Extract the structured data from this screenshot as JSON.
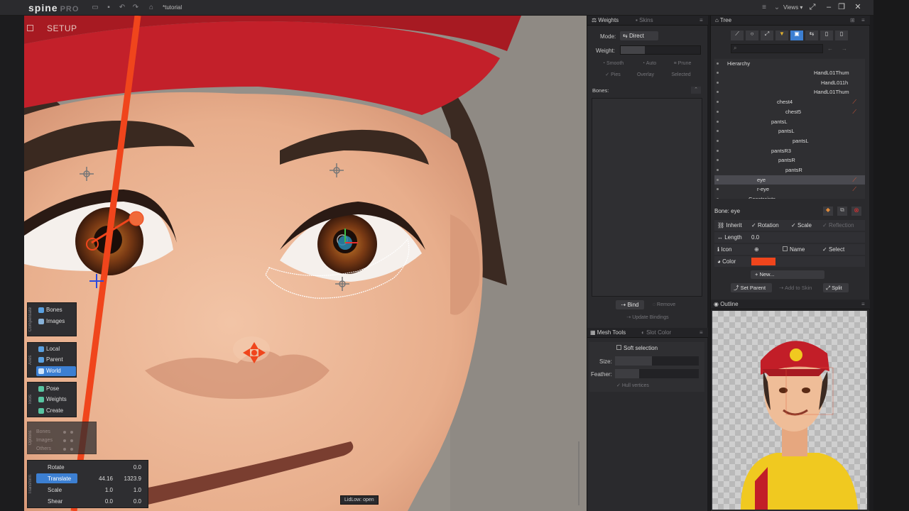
{
  "app": {
    "logo": "spine",
    "logo_suffix": "PRO",
    "document_title": "*tutorial",
    "views_menu": "Views"
  },
  "viewport": {
    "mode_label": "SETUP",
    "status_text": "LidLow: open"
  },
  "compensate": {
    "label": "Compensate",
    "items": [
      {
        "label": "Bones"
      },
      {
        "label": "Images"
      }
    ]
  },
  "axes": {
    "label": "Axes",
    "items": [
      {
        "label": "Local",
        "active": false
      },
      {
        "label": "Parent",
        "active": false
      },
      {
        "label": "World",
        "active": true
      }
    ]
  },
  "tools": {
    "label": "Tools",
    "items": [
      {
        "label": "Pose",
        "active": false
      },
      {
        "label": "Weights",
        "active": false
      },
      {
        "label": "Create",
        "active": false
      }
    ]
  },
  "options": {
    "label": "Options",
    "rows": [
      "Bones",
      "Images",
      "Others"
    ]
  },
  "transform": {
    "label": "Transform",
    "rows": [
      {
        "label": "Rotate",
        "v1": "",
        "v2": "0.0",
        "active": false
      },
      {
        "label": "Translate",
        "v1": "44.16",
        "v2": "1323.9",
        "active": true
      },
      {
        "label": "Scale",
        "v1": "1.0",
        "v2": "1.0",
        "active": false
      },
      {
        "label": "Shear",
        "v1": "0.0",
        "v2": "0.0",
        "active": false
      }
    ]
  },
  "weights_panel": {
    "tabs": [
      "Weights",
      "Skins"
    ],
    "mode_label": "Mode:",
    "mode_value": "Direct",
    "weight_label": "Weight:",
    "buttons_row1": [
      "Smooth",
      "Auto",
      "Prune"
    ],
    "buttons_row2": [
      "Pies",
      "Overlay",
      "Selected"
    ],
    "bones_label": "Bones:",
    "bind_label": "Bind",
    "remove_label": "Remove",
    "update_label": "Update Bindings"
  },
  "mesh_tools": {
    "tabs": [
      "Mesh Tools",
      "Slot Color"
    ],
    "soft_selection": "Soft selection",
    "size_label": "Size:",
    "feather_label": "Feather:",
    "hull_label": "Hull vertices"
  },
  "tree": {
    "title": "Tree",
    "hierarchy_label": "Hierarchy",
    "rows": [
      {
        "label": "HandL01Thum",
        "indent": 140,
        "selected": false,
        "red": false
      },
      {
        "label": "HandL011h",
        "indent": 150,
        "selected": false,
        "red": false
      },
      {
        "label": "HandL01Thum",
        "indent": 140,
        "selected": false,
        "red": false
      },
      {
        "label": "chest4",
        "indent": 88,
        "selected": false,
        "red": true
      },
      {
        "label": "chest5",
        "indent": 100,
        "selected": false,
        "red": true
      },
      {
        "label": "pantsL",
        "indent": 80,
        "selected": false,
        "red": false
      },
      {
        "label": "pantsL",
        "indent": 90,
        "selected": false,
        "red": false
      },
      {
        "label": "pantsL",
        "indent": 110,
        "selected": false,
        "red": false
      },
      {
        "label": "pantsR3",
        "indent": 80,
        "selected": false,
        "red": false
      },
      {
        "label": "pantsR",
        "indent": 90,
        "selected": false,
        "red": false
      },
      {
        "label": "pantsR",
        "indent": 100,
        "selected": false,
        "red": false
      },
      {
        "label": "eye",
        "indent": 60,
        "selected": true,
        "red": true
      },
      {
        "label": "r-eye",
        "indent": 60,
        "selected": false,
        "red": true
      },
      {
        "label": "Constraints",
        "indent": 48,
        "selected": false,
        "red": false
      }
    ],
    "bone_title": "Bone: eye",
    "inherit_label": "Inherit",
    "rotation_label": "Rotation",
    "scale_label": "Scale",
    "reflection_label": "Reflection",
    "length_label": "Length",
    "length_value": "0.0",
    "icon_label": "Icon",
    "name_label": "Name",
    "select_label": "Select",
    "color_label": "Color",
    "color_value": "#f0451c",
    "new_label": "New...",
    "set_parent_label": "Set Parent",
    "add_to_skin_label": "Add to Skin",
    "split_label": "Split"
  },
  "outline": {
    "title": "Outline"
  },
  "colors": {
    "accent": "#3c7fd2",
    "bone": "#f0451c"
  }
}
